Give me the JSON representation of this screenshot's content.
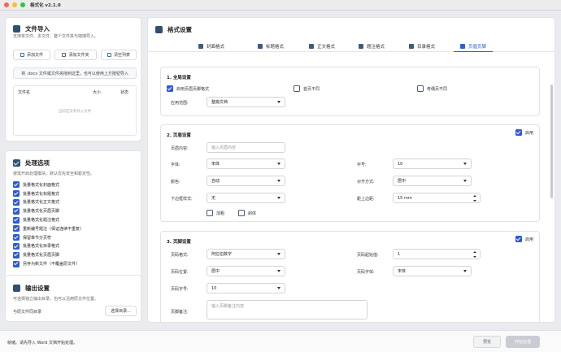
{
  "app": {
    "title": "格式化 v2.1.0"
  },
  "colors": {
    "accent": "#2e5bd7",
    "icon": "#2f4f73"
  },
  "import_panel": {
    "title": "文件导入",
    "subtitle": "支持单文件、多文件、整个文件夹与拖拽导入。",
    "add_file": "添加文件",
    "add_folder": "添加文件夹",
    "clear_list": "清空列表",
    "drop_hint": "将 .docx 文件或文件夹拖到这里，也可以使用上方按钮导入",
    "col_name": "文件名",
    "col_size": "大小",
    "col_status": "状态",
    "empty": "当前还没有导入文件"
  },
  "options_panel": {
    "title": "处理选项",
    "subtitle": "按需开启处理模块，默认优先安全和稳定性。",
    "options": [
      {
        "label": "批量格式化封面格式",
        "checked": true
      },
      {
        "label": "批量格式化标题格式",
        "checked": true
      },
      {
        "label": "批量格式化正文格式",
        "checked": true
      },
      {
        "label": "批量格式化页眉页脚",
        "checked": true
      },
      {
        "label": "批量格式化题注格式",
        "checked": true
      },
      {
        "label": "重新编号题注（保证连续不重复）",
        "checked": true
      },
      {
        "label": "保留章节分页符",
        "checked": true
      },
      {
        "label": "批量格式化目录格式",
        "checked": true
      },
      {
        "label": "批量格式化页眉页脚",
        "checked": true
      },
      {
        "label": "另存为新文件（不覆盖原文件）",
        "checked": true
      }
    ]
  },
  "output_panel": {
    "title": "输出设置",
    "subtitle": "可选择独立输出目录，也可以沿用原文件位置。",
    "path_text": "与原文件同目录",
    "choose_btn": "选择目录..."
  },
  "format": {
    "title": "格式设置",
    "tabs": [
      "封面格式",
      "标题格式",
      "正文格式",
      "题注格式",
      "目录格式",
      "页眉页脚"
    ],
    "active_tab": "页眉页脚"
  },
  "global": {
    "title": "1. 全局设置",
    "enable_label": "启用页眉页脚格式",
    "first_page": "首页不同",
    "odd_even": "奇偶页不同",
    "scope_label": "应用范围:",
    "scope_value": "整篇文档"
  },
  "header": {
    "title": "2. 页眉设置",
    "enable_label": "启用",
    "content_label": "页眉内容:",
    "content_placeholder": "输入页眉内容",
    "font_label": "字体:",
    "font_value": "宋体",
    "size_label": "字号:",
    "size_value": "10",
    "color_label": "颜色:",
    "color_value": "自动",
    "align_label": "对齐方式:",
    "align_value": "居中",
    "border_label": "下边框样式:",
    "border_value": "无",
    "top_label": "距上边距:",
    "top_value": "15 mm",
    "bold": "加粗",
    "italic": "斜体"
  },
  "footer": {
    "title": "3. 页脚设置",
    "enable_label": "启用",
    "num_format_label": "页码格式:",
    "num_format_value": "阿拉伯数字",
    "start_label": "页码起始值:",
    "start_value": "1",
    "pos_label": "页码位置:",
    "pos_value": "居中",
    "font_label": "页码字体:",
    "font_value": "宋体",
    "size_label": "页码字号:",
    "size_value": "10",
    "note_label": "页脚备注:",
    "note_placeholder": "输入页脚备注内容"
  },
  "status": {
    "text": "就绪。请先导入 Word 文档开始处理。",
    "preview_btn": "预览",
    "start_btn": "开始处理"
  }
}
